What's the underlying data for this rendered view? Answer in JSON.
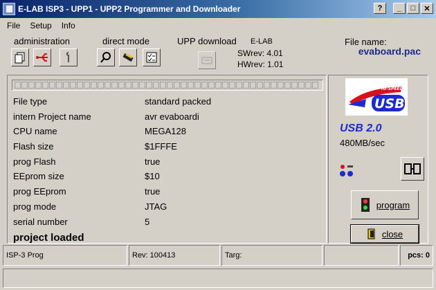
{
  "window": {
    "title": "E-LAB  ISP3 - UPP1 - UPP2 Programmer and Downloader"
  },
  "menu": [
    "File",
    "Setup",
    "Info"
  ],
  "toolbar": {
    "administration_label": "administration",
    "direct_mode_label": "direct mode",
    "upp_download_label": "UPP download",
    "elab": "E-LAB",
    "swrev": "SWrev:  4.01",
    "hwrev": "HWrev:  1.01"
  },
  "file": {
    "label": "File name:",
    "value": "evaboard.pac"
  },
  "info": [
    {
      "key": "File type",
      "value": "standard packed"
    },
    {
      "key": "intern Project name",
      "value": "avr evaboardi"
    },
    {
      "key": "CPU name",
      "value": "MEGA128"
    },
    {
      "key": "Flash size",
      "value": "$1FFFE"
    },
    {
      "key": "prog Flash",
      "value": "true"
    },
    {
      "key": "EEprom size",
      "value": "$10"
    },
    {
      "key": "prog EEprom",
      "value": "true"
    },
    {
      "key": "prog mode",
      "value": "JTAG"
    },
    {
      "key": "serial number",
      "value": "5"
    }
  ],
  "status": "project loaded",
  "usb": {
    "badge": "HI-SPEED",
    "logo": "USB",
    "label": "USB 2.0",
    "speed": "480MB/sec"
  },
  "buttons": {
    "program": "program",
    "close": "close"
  },
  "statusbar": {
    "prog": "ISP-3 Prog",
    "rev": "Rev: 100413",
    "targ": "Targ:",
    "pcs": "pcs: 0"
  },
  "colors": {
    "title_start": "#0a246a",
    "title_end": "#a6caf0",
    "accent_blue": "#1c2a8c",
    "usb_blue": "#1c2ad0"
  }
}
